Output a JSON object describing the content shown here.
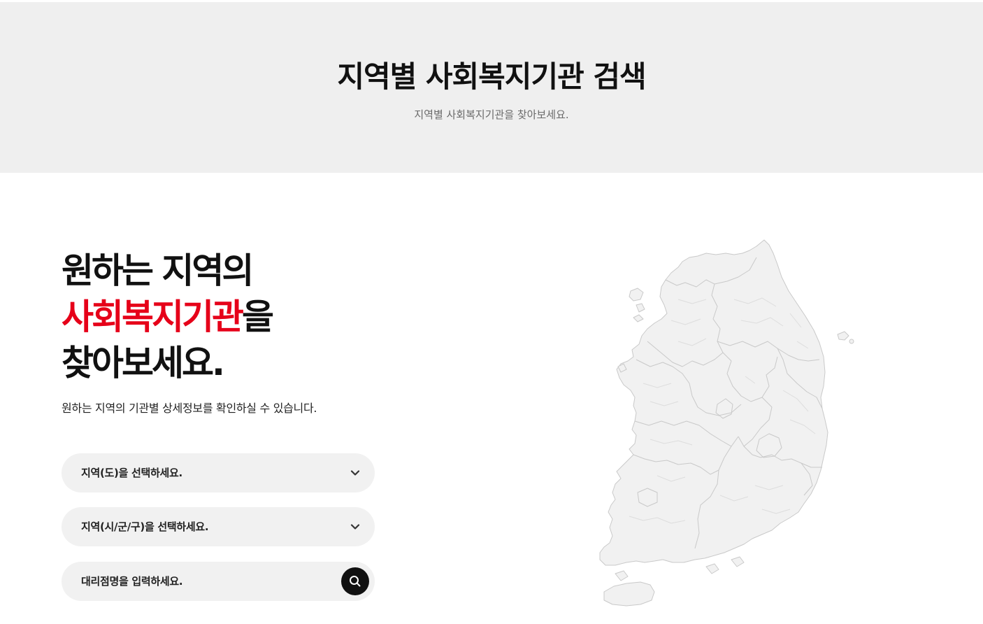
{
  "header": {
    "title": "지역별 사회복지기관 검색",
    "subtitle": "지역별 사회복지기관을 찾아보세요."
  },
  "intro": {
    "line1": "원하는 지역의",
    "line2_highlight": "사회복지기관",
    "line2_rest": "을",
    "line3": "찾아보세요.",
    "description": "원하는 지역의 기관별 상세정보를 확인하실 수 있습니다.",
    "accent_color": "#e60019"
  },
  "form": {
    "province_select": "지역(도)을 선택하세요.",
    "district_select": "지역(시/군/구)을 선택하세요.",
    "branch_input_placeholder": "대리점명을 입력하세요."
  },
  "icons": {
    "select_arrow": "chevron-down-icon",
    "search": "search-icon"
  }
}
